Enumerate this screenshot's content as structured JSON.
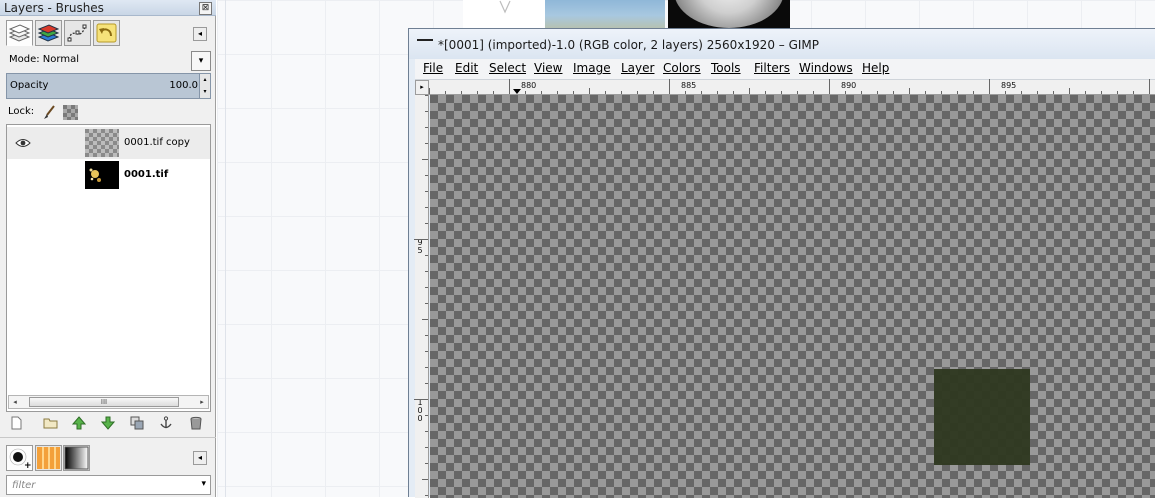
{
  "dock": {
    "title": "Layers - Brushes",
    "close_glyph": "⊠",
    "tabs": [
      {
        "icon": "layers-icon"
      },
      {
        "icon": "channels-icon"
      },
      {
        "icon": "paths-icon"
      },
      {
        "icon": "undo-history-icon"
      }
    ],
    "tab_menu_glyph": "◂",
    "mode_label": "Mode: Normal",
    "mode_dropdown_glyph": "▾",
    "opacity_label": "Opacity",
    "opacity_value": "100.0",
    "lock_label": "Lock:",
    "layers": [
      {
        "name": "0001.tif copy",
        "visible": true,
        "selected": true
      },
      {
        "name": "0001.tif",
        "visible": false,
        "selected": false
      }
    ],
    "scroll_left": "◂",
    "scroll_right": "▸",
    "scroll_grip": "III",
    "layer_buttons": [
      {
        "icon": "new-layer-icon"
      },
      {
        "icon": "new-layer-group-icon"
      },
      {
        "icon": "raise-layer-icon"
      },
      {
        "icon": "lower-layer-icon"
      },
      {
        "icon": "duplicate-layer-icon"
      },
      {
        "icon": "anchor-layer-icon"
      },
      {
        "icon": "delete-layer-icon"
      }
    ],
    "brush_tabs": [
      {
        "icon": "brushes-icon"
      },
      {
        "icon": "patterns-icon"
      },
      {
        "icon": "gradients-icon"
      }
    ],
    "filter_placeholder": "filter",
    "filter_dropdown_glyph": "▾"
  },
  "image_window": {
    "title": "*[0001] (imported)-1.0 (RGB color, 2 layers) 2560x1920 – GIMP",
    "menu": [
      "File",
      "Edit",
      "Select",
      "View",
      "Image",
      "Layer",
      "Colors",
      "Tools",
      "Filters",
      "Windows",
      "Help"
    ],
    "ruler_corner_glyph": "▸",
    "ruler_h_labels": [
      "880",
      "885",
      "890",
      "895"
    ],
    "ruler_v_labels": [
      "95",
      "100"
    ],
    "patch_color": "#2f3921"
  }
}
